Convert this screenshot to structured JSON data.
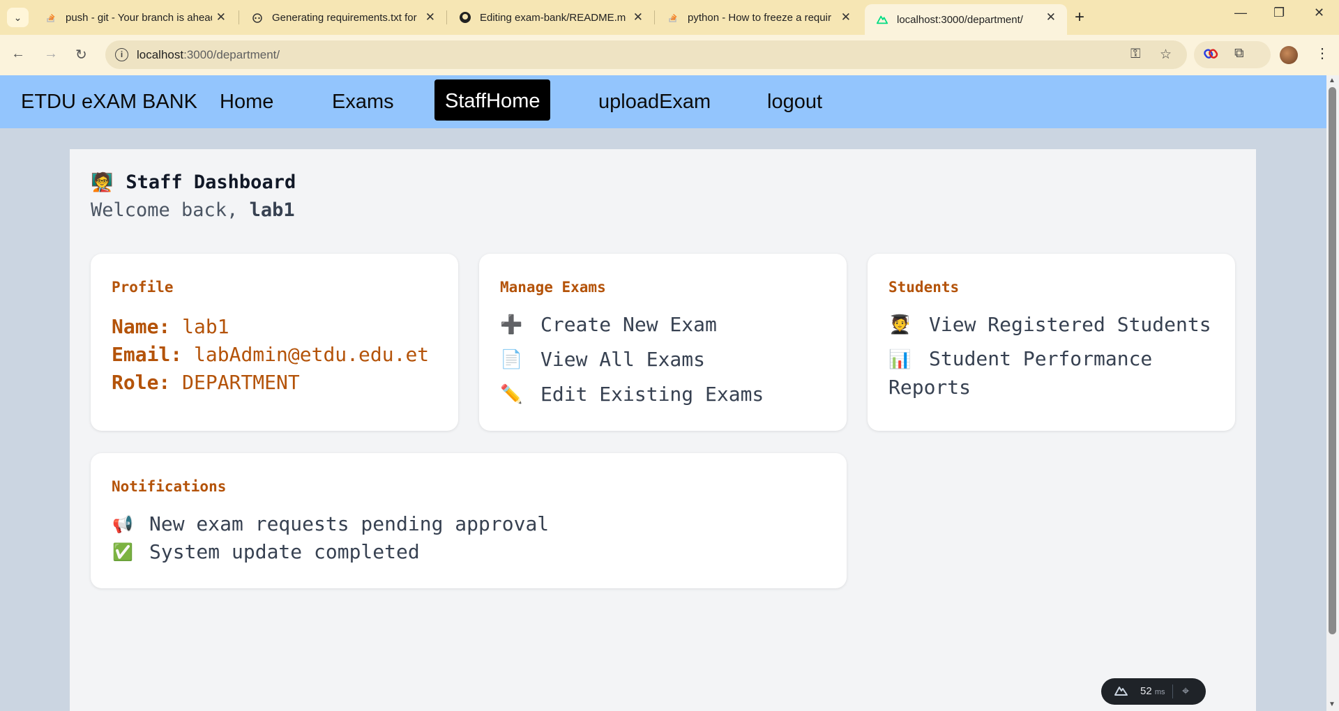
{
  "browser": {
    "tabs": [
      {
        "title": "push - git - Your branch is ahead",
        "icon": "stackoverflow-icon"
      },
      {
        "title": "Generating requirements.txt for",
        "icon": "copilot-icon"
      },
      {
        "title": "Editing exam-bank/README.md",
        "icon": "github-icon"
      },
      {
        "title": "python - How to freeze a requir",
        "icon": "stackoverflow-icon"
      },
      {
        "title": "localhost:3000/department/",
        "icon": "nuxt-icon",
        "active": true
      }
    ],
    "url_host": "localhost",
    "url_rest": ":3000/department/"
  },
  "nav": {
    "brand": "ETDU eXAM BANK",
    "links": [
      "Home",
      "Exams",
      "StaffHome",
      "uploadExam",
      "logout"
    ],
    "active": "StaffHome"
  },
  "dashboard": {
    "title_emoji": "🧑‍🏫",
    "title": "Staff Dashboard",
    "welcome_prefix": "Welcome back, ",
    "username": "lab1"
  },
  "profile": {
    "heading": "Profile",
    "name_label": "Name:",
    "name": "lab1",
    "email_label": "Email:",
    "email": "labAdmin@etdu.edu.et",
    "role_label": "Role:",
    "role": "DEPARTMENT"
  },
  "manage_exams": {
    "heading": "Manage Exams",
    "items": [
      {
        "icon": "➕",
        "label": "Create New Exam"
      },
      {
        "icon": "📄",
        "label": "View All Exams"
      },
      {
        "icon": "✏️",
        "label": "Edit Existing Exams"
      }
    ]
  },
  "students": {
    "heading": "Students",
    "items": [
      {
        "icon": "🧑‍🎓",
        "label": "View Registered Students"
      },
      {
        "icon": "📊",
        "label": "Student Performance Reports"
      }
    ]
  },
  "notifications": {
    "heading": "Notifications",
    "items": [
      {
        "icon": "📢",
        "label": "New exam requests pending approval"
      },
      {
        "icon": "✅",
        "label": "System update completed"
      }
    ]
  },
  "devtools": {
    "value": "52",
    "unit": "ms"
  },
  "colors": {
    "nav_bg": "#93c5fd",
    "accent": "#b45309",
    "page_bg": "#cbd5e1"
  }
}
